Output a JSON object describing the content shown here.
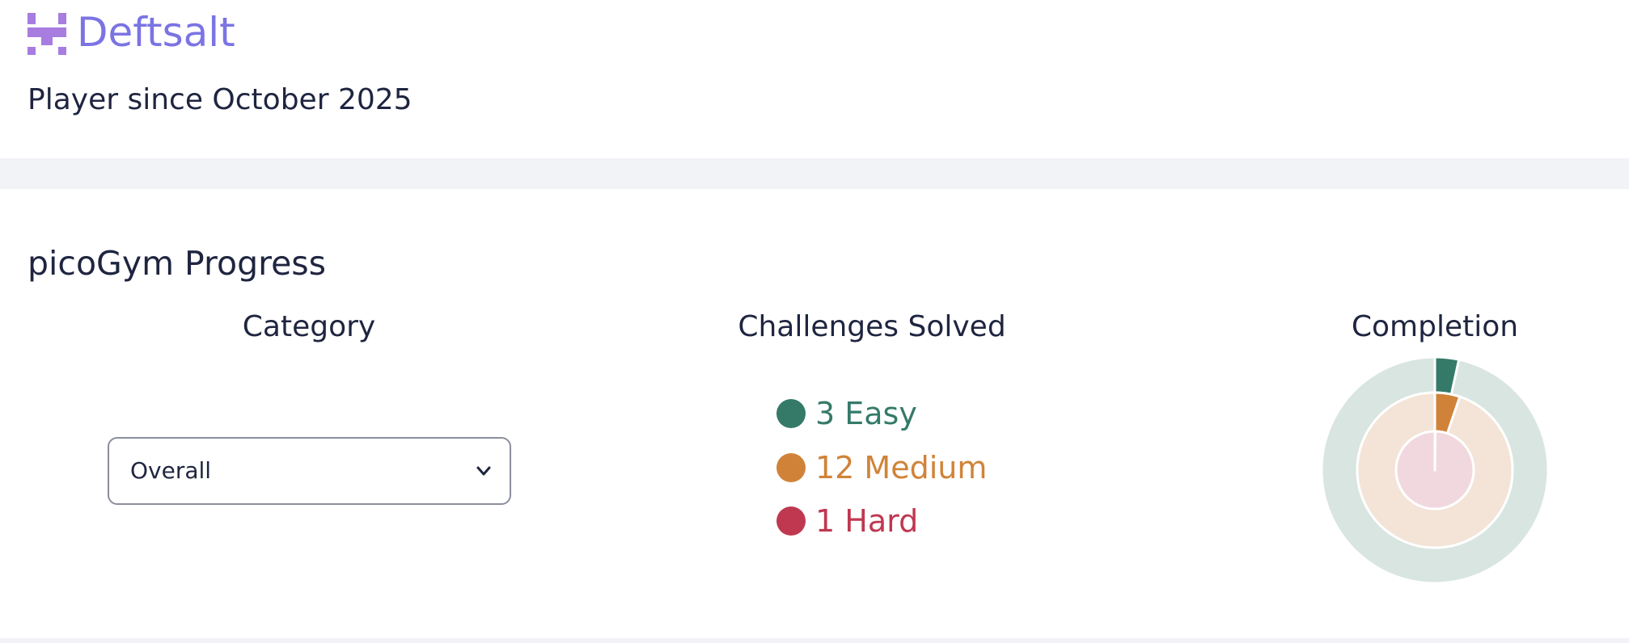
{
  "profile": {
    "username": "Deftsalt",
    "player_since": "Player since October 2025"
  },
  "progress": {
    "title": "picoGym Progress",
    "category_heading": "Category",
    "solved_heading": "Challenges Solved",
    "completion_heading": "Completion",
    "category_select": {
      "selected": "Overall"
    },
    "solved": [
      {
        "label": "3 Easy",
        "count": 3,
        "difficulty": "Easy",
        "color": "#357a69"
      },
      {
        "label": "12 Medium",
        "count": 12,
        "difficulty": "Medium",
        "color": "#d08338"
      },
      {
        "label": "1 Hard",
        "count": 1,
        "difficulty": "Hard",
        "color": "#bf3850"
      }
    ],
    "completion": {
      "easy_fraction": 0.034,
      "medium_fraction": 0.052,
      "hard_fraction": 0.002
    }
  },
  "colors": {
    "brand": "#7b74e3",
    "logo": "#a77de0",
    "text": "#1f2540",
    "page_bg": "#f2f3f7",
    "easy_track": "#d8e5e1",
    "medium_track": "#f3e4d7",
    "hard_track": "#f1d7de"
  },
  "icons": {
    "logo": "pico-logo-icon",
    "select_chevron": "chevron-down-icon"
  }
}
